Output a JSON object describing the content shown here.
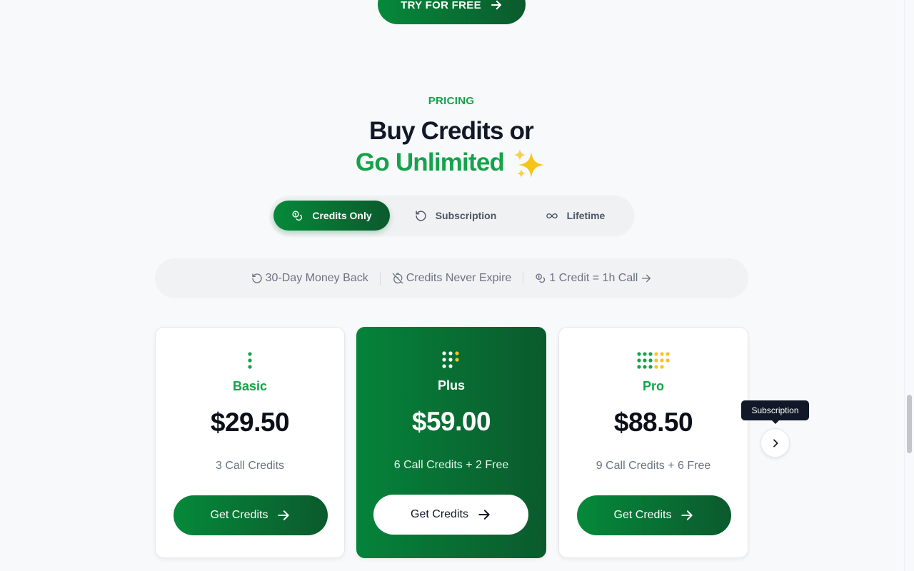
{
  "hero": {
    "cta_label": "TRY FOR FREE"
  },
  "pricing": {
    "eyebrow": "PRICING",
    "headline_line1": "Buy Credits or",
    "headline_line2": "Go Unlimited"
  },
  "tabs": [
    {
      "label": "Credits Only",
      "icon": "coins-icon",
      "active": true
    },
    {
      "label": "Subscription",
      "icon": "refresh-icon",
      "active": false
    },
    {
      "label": "Lifetime",
      "icon": "infinity-icon",
      "active": false
    }
  ],
  "features": [
    {
      "label": "30-Day Money Back",
      "icon": "refresh-icon"
    },
    {
      "label": "Credits Never Expire",
      "icon": "timer-off-icon"
    },
    {
      "label": "1 Credit = 1h Call",
      "icon": "coins-icon"
    }
  ],
  "plans": [
    {
      "name": "Basic",
      "price": "$29.50",
      "credits": "3 Call Credits",
      "cta": "Get Credits",
      "highlighted": false
    },
    {
      "name": "Plus",
      "price": "$59.00",
      "credits": "6 Call Credits + 2 Free",
      "cta": "Get Credits",
      "highlighted": true
    },
    {
      "name": "Pro",
      "price": "$88.50",
      "credits": "9 Call Credits + 6 Free",
      "cta": "Get Credits",
      "highlighted": false
    }
  ],
  "carousel": {
    "tooltip": "Subscription"
  },
  "colors": {
    "brand_green": "#14a34a",
    "dark_green": "#0b5a2d",
    "gold": "#f5c518"
  }
}
